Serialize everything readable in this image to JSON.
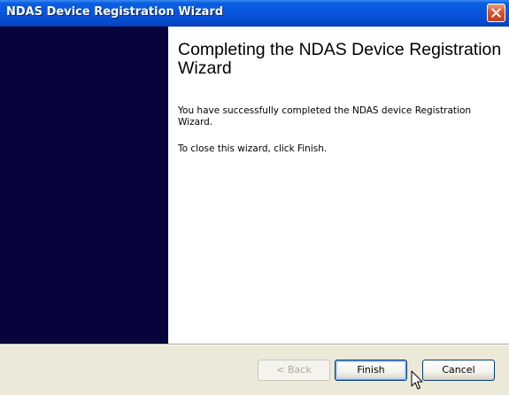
{
  "window": {
    "title": "NDAS Device Registration Wizard"
  },
  "content": {
    "heading": "Completing the NDAS Device Registration Wizard",
    "paragraph1": "You have successfully completed the NDAS device Registration Wizard.",
    "paragraph2": "To close this wizard, click Finish."
  },
  "buttons": {
    "back": "< Back",
    "finish": "Finish",
    "cancel": "Cancel"
  },
  "colors": {
    "titlebar": "#0855DD",
    "sidebar": "#06043A",
    "content_background": "#FFFFFF",
    "button_face": "#ECE9D8"
  },
  "icons": [
    "close-icon",
    "mouse-cursor-icon"
  ]
}
